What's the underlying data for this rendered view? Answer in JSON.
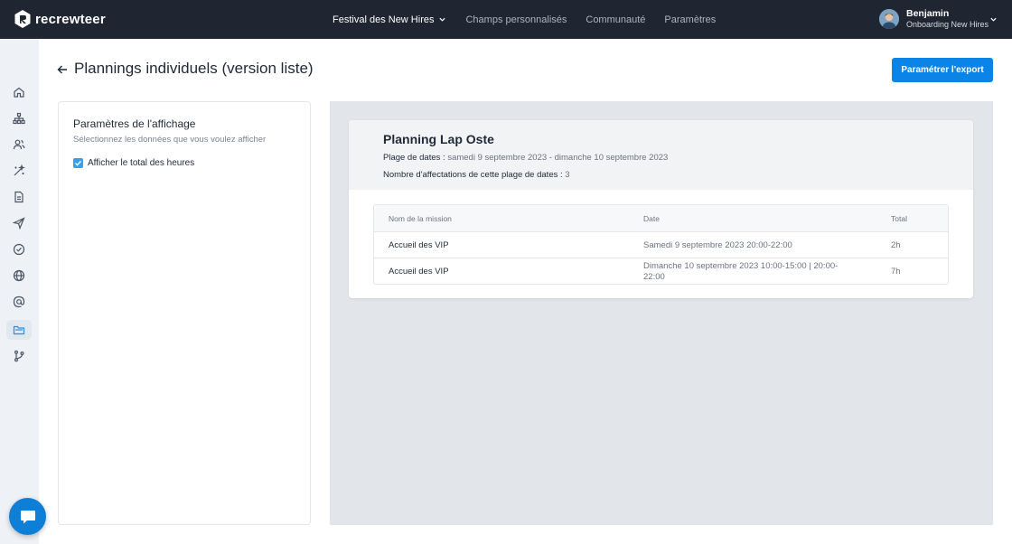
{
  "app": {
    "brand": "recrewteer",
    "nav": [
      {
        "label": "Festival des New Hires",
        "active": true,
        "has_dropdown": true
      },
      {
        "label": "Champs personnalisés",
        "active": false
      },
      {
        "label": "Communauté",
        "active": false
      },
      {
        "label": "Paramètres",
        "active": false
      }
    ],
    "user": {
      "name": "Benjamin",
      "role": "Onboarding New Hires"
    }
  },
  "sidebar": {
    "icons": [
      "home-icon",
      "org-chart-icon",
      "user-group-icon",
      "magic-wand-icon",
      "document-icon",
      "send-icon",
      "check-circle-icon",
      "globe-icon",
      "at-icon",
      "folder-icon",
      "branch-icon"
    ],
    "active_icon": "folder-icon"
  },
  "page": {
    "title": "Plannings individuels (version liste)",
    "export_button": "Paramétrer l'export"
  },
  "settings": {
    "title": "Paramètres de l'affichage",
    "subtitle": "Sélectionnez les données que vous voulez afficher",
    "checkbox_label": "Afficher le total des heures",
    "checkbox_checked": true
  },
  "planning": {
    "title": "Planning Lap Oste",
    "date_range_label": "Plage de dates :",
    "date_range_value": "samedi 9 septembre 2023 - dimanche 10 septembre 2023",
    "count_label": "Nombre d'affectations de cette plage de dates :",
    "count_value": "3",
    "table": {
      "headers": [
        "Nom de la mission",
        "Date",
        "Total"
      ],
      "rows": [
        [
          "Accueil des VIP",
          "Samedi 9 septembre 2023 20:00-22:00",
          "2h"
        ],
        [
          "Accueil des VIP",
          "Dimanche 10 septembre 2023 10:00-15:00 | 20:00-22:00",
          "7h"
        ]
      ]
    }
  },
  "colors": {
    "topbar": "#1f2531",
    "primary": "#0b84e8",
    "sidebar_bg": "#eef1f5",
    "preview_bg": "#e2e5ea"
  }
}
